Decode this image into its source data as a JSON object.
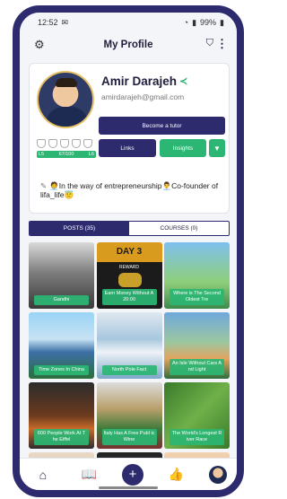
{
  "status": {
    "time": "12:52",
    "battery": "99%"
  },
  "header": {
    "title": "My Profile"
  },
  "profile": {
    "name": "Amir Darajeh",
    "email": "amirdarajeh@gmail.com",
    "level_left": "L5",
    "level_mid": "67/100",
    "level_right": "L6",
    "bio": "🧑‍💼In the way of entrepreneurship👨‍💼Co-founder of lifa_life😇"
  },
  "actions": {
    "tutor_label": "Become a tutor",
    "links_label": "Links",
    "insights_label": "Insights"
  },
  "tabs": [
    {
      "label": "POSTS (35)"
    },
    {
      "label": "COURSES (0)"
    }
  ],
  "posts": [
    {
      "caption": "Gandhi"
    },
    {
      "caption": "Earn Money Without A 20:00"
    },
    {
      "caption": "Where is The Second Oldest Tre"
    },
    {
      "caption": "Time Zones In China"
    },
    {
      "caption": "North Pole Fact"
    },
    {
      "caption": "An Isle Without Cars A nd Light"
    },
    {
      "caption": "600 People Work At T he Eiffel"
    },
    {
      "caption": "Italy Has A Free Publ ic Wine"
    },
    {
      "caption": "The World's Longest R iver Race"
    },
    {
      "caption": ""
    },
    {
      "caption": ""
    },
    {
      "caption": ""
    }
  ],
  "post_tile_texts": {
    "day_label": "DAY 3",
    "reward_label": "REWARD"
  },
  "icons": {
    "settings": "gear-icon",
    "shield": "shield-icon",
    "more": "kebab-icon",
    "share": "share-icon",
    "edit": "pencil-icon",
    "home": "home-icon",
    "library": "book-icon",
    "add": "plus-icon",
    "likes": "thumbs-up-icon"
  },
  "colors": {
    "primary": "#2d2a6e",
    "accent": "#2bb673"
  }
}
